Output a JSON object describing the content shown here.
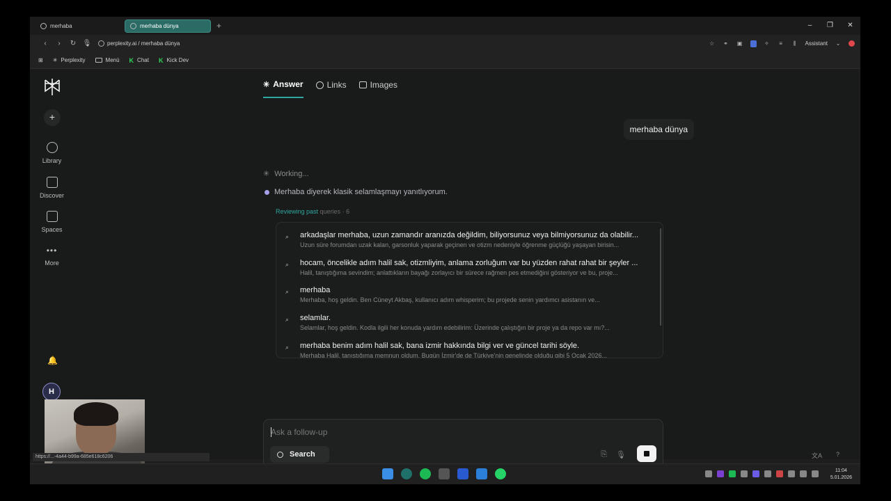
{
  "browser": {
    "tabs": [
      {
        "label": "merhaba",
        "active": false
      },
      {
        "label": "merhaba dünya",
        "active": true
      }
    ],
    "url": "perplexity.ai / merhaba dünya",
    "assistant_label": "Assistant",
    "bookmarks": [
      "Perplexity",
      "Menü",
      "Chat",
      "Kick Dev"
    ],
    "status_url": "https://...-4a44-b99a-685e618c6206"
  },
  "sidebar": {
    "items": [
      {
        "label": "Library",
        "icon": "library-icon"
      },
      {
        "label": "Discover",
        "icon": "discover-icon"
      },
      {
        "label": "Spaces",
        "icon": "spaces-icon"
      },
      {
        "label": "More",
        "icon": "more-icon"
      }
    ],
    "avatar_initial": "H"
  },
  "content_tabs": [
    {
      "label": "Answer",
      "active": true
    },
    {
      "label": "Links",
      "active": false
    },
    {
      "label": "Images",
      "active": false
    }
  ],
  "user_message": "merhaba dünya",
  "working_label": "Working...",
  "step_text": "Merhaba diyerek klasik selamlaşmayı yanıtlıyorum.",
  "review": {
    "label": "Reviewing past",
    "suffix": "queries · 6"
  },
  "queries": [
    {
      "title": "arkadaşlar merhaba, uzun zamandır aranızda değildim, biliyorsunuz veya bilmiyorsunuz da olabilir...",
      "snippet": "Uzun süre forumdan uzak kalan, garsonluk yaparak geçinen ve otizm nedeniyle öğrenme güçlüğü yaşayan birisin..."
    },
    {
      "title": "hocam, öncelikle adım halil sak, otizmliyim, anlama zorluğum var bu yüzden rahat rahat bir şeyler ...",
      "snippet": "Halil, tanıştığıma sevindim; anlattıkların bayağı zorlayıcı bir sürece rağmen pes etmediğini gösteriyor ve bu, proje..."
    },
    {
      "title": "merhaba",
      "snippet": "Merhaba, hoş geldin. Ben Cüneyt Akbaş, kullanıcı adım whisperim; bu projede senin yardımcı asistanın ve..."
    },
    {
      "title": "selamlar.",
      "snippet": "Selamlar, hoş geldin. Kodla ilgili her konuda yardım edebilirim: Üzerinde çalıştığın bir proje ya da repo var mı?..."
    },
    {
      "title": "merhaba benim adım halil sak, bana izmir hakkında bilgi ver ve güncel tarihi söyle.",
      "snippet": "Merhaba Halil, tanıştığıma memnun oldum. Bugün İzmir'de de Türkiye'nin genelinde olduğu gibi 5 Ocak 2026..."
    }
  ],
  "followup": {
    "placeholder": "Ask a follow-up",
    "search_label": "Search"
  },
  "clock": {
    "time": "11:04",
    "date": "5.01.2026"
  }
}
